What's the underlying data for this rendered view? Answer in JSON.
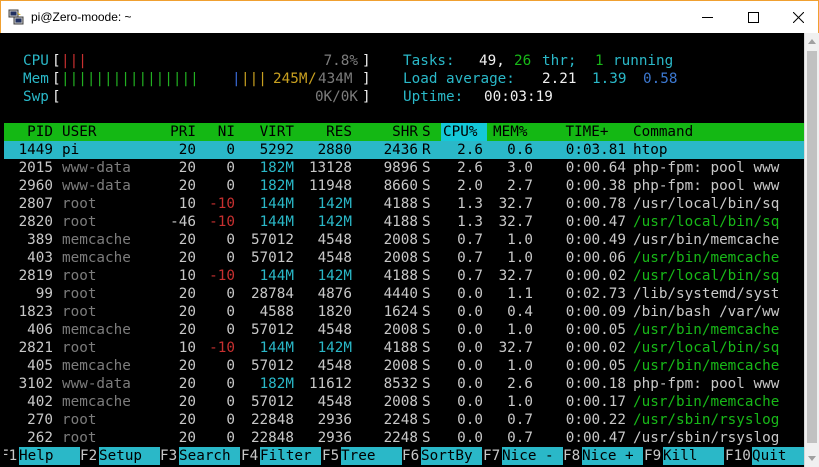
{
  "window": {
    "title": "pi@Zero-moode: ~",
    "minimize_label": "─",
    "maximize_label": "☐",
    "close_label": "✕"
  },
  "meters": {
    "cpu": {
      "label": "CPU",
      "bar": "|||",
      "value": "7.8%"
    },
    "mem": {
      "label": "Mem",
      "bar_green": "||||||||||||||||",
      "bar_blue": "|",
      "bar_yellow": "|||",
      "used": "245M",
      "sep": "/",
      "total": "434M"
    },
    "swp": {
      "label": "Swp",
      "value": "0K/0K"
    },
    "tasks": {
      "label": "Tasks:",
      "count": "49,",
      "thr": "26",
      "thr_label": "thr;",
      "running": "1",
      "running_label": "running"
    },
    "load": {
      "label": "Load average:",
      "v1": "2.21",
      "v5": "1.39",
      "v15": "0.58"
    },
    "uptime": {
      "label": "Uptime:",
      "value": "00:03:19"
    }
  },
  "columns": [
    "PID",
    "USER",
    "PRI",
    "NI",
    "VIRT",
    "RES",
    "SHR",
    "S",
    "CPU%",
    "MEM%",
    "TIME+",
    "Command"
  ],
  "processes": [
    {
      "pid": "1449",
      "user": "pi",
      "pri": "20",
      "ni": "0",
      "virt": "5292",
      "res": "2880",
      "shr": "2436",
      "s": "R",
      "cpu": "2.6",
      "mem": "0.6",
      "time": "0:03.81",
      "cmd": "htop"
    },
    {
      "pid": "2015",
      "user": "www-data",
      "pri": "20",
      "ni": "0",
      "virt": "182M",
      "res": "13128",
      "shr": "9896",
      "s": "S",
      "cpu": "2.6",
      "mem": "3.0",
      "time": "0:00.64",
      "cmd": "php-fpm: pool www"
    },
    {
      "pid": "2960",
      "user": "www-data",
      "pri": "20",
      "ni": "0",
      "virt": "182M",
      "res": "11948",
      "shr": "8660",
      "s": "S",
      "cpu": "2.0",
      "mem": "2.7",
      "time": "0:00.38",
      "cmd": "php-fpm: pool www"
    },
    {
      "pid": "2807",
      "user": "root",
      "pri": "10",
      "ni": "-10",
      "virt": "144M",
      "res": "142M",
      "shr": "4188",
      "s": "S",
      "cpu": "1.3",
      "mem": "32.7",
      "time": "0:00.78",
      "cmd": "/usr/local/bin/sq"
    },
    {
      "pid": "2820",
      "user": "root",
      "pri": "-46",
      "ni": "-10",
      "virt": "144M",
      "res": "142M",
      "shr": "4188",
      "s": "S",
      "cpu": "1.3",
      "mem": "32.7",
      "time": "0:00.47",
      "cmd": "/usr/local/bin/sq"
    },
    {
      "pid": "389",
      "user": "memcache",
      "pri": "20",
      "ni": "0",
      "virt": "57012",
      "res": "4548",
      "shr": "2008",
      "s": "S",
      "cpu": "0.7",
      "mem": "1.0",
      "time": "0:00.49",
      "cmd": "/usr/bin/memcache"
    },
    {
      "pid": "403",
      "user": "memcache",
      "pri": "20",
      "ni": "0",
      "virt": "57012",
      "res": "4548",
      "shr": "2008",
      "s": "S",
      "cpu": "0.7",
      "mem": "1.0",
      "time": "0:00.06",
      "cmd": "/usr/bin/memcache"
    },
    {
      "pid": "2819",
      "user": "root",
      "pri": "10",
      "ni": "-10",
      "virt": "144M",
      "res": "142M",
      "shr": "4188",
      "s": "S",
      "cpu": "0.7",
      "mem": "32.7",
      "time": "0:00.02",
      "cmd": "/usr/local/bin/sq"
    },
    {
      "pid": "99",
      "user": "root",
      "pri": "20",
      "ni": "0",
      "virt": "28784",
      "res": "4876",
      "shr": "4440",
      "s": "S",
      "cpu": "0.0",
      "mem": "1.1",
      "time": "0:02.73",
      "cmd": "/lib/systemd/syst"
    },
    {
      "pid": "1823",
      "user": "root",
      "pri": "20",
      "ni": "0",
      "virt": "4588",
      "res": "1820",
      "shr": "1624",
      "s": "S",
      "cpu": "0.0",
      "mem": "0.4",
      "time": "0:00.09",
      "cmd": "/bin/bash /var/ww"
    },
    {
      "pid": "406",
      "user": "memcache",
      "pri": "20",
      "ni": "0",
      "virt": "57012",
      "res": "4548",
      "shr": "2008",
      "s": "S",
      "cpu": "0.0",
      "mem": "1.0",
      "time": "0:00.05",
      "cmd": "/usr/bin/memcache"
    },
    {
      "pid": "2821",
      "user": "root",
      "pri": "10",
      "ni": "-10",
      "virt": "144M",
      "res": "142M",
      "shr": "4188",
      "s": "S",
      "cpu": "0.0",
      "mem": "32.7",
      "time": "0:00.02",
      "cmd": "/usr/local/bin/sq"
    },
    {
      "pid": "405",
      "user": "memcache",
      "pri": "20",
      "ni": "0",
      "virt": "57012",
      "res": "4548",
      "shr": "2008",
      "s": "S",
      "cpu": "0.0",
      "mem": "1.0",
      "time": "0:00.05",
      "cmd": "/usr/bin/memcache"
    },
    {
      "pid": "3102",
      "user": "www-data",
      "pri": "20",
      "ni": "0",
      "virt": "182M",
      "res": "11612",
      "shr": "8532",
      "s": "S",
      "cpu": "0.0",
      "mem": "2.6",
      "time": "0:00.18",
      "cmd": "php-fpm: pool www"
    },
    {
      "pid": "402",
      "user": "memcache",
      "pri": "20",
      "ni": "0",
      "virt": "57012",
      "res": "4548",
      "shr": "2008",
      "s": "S",
      "cpu": "0.0",
      "mem": "1.0",
      "time": "0:00.17",
      "cmd": "/usr/bin/memcache"
    },
    {
      "pid": "270",
      "user": "root",
      "pri": "20",
      "ni": "0",
      "virt": "22848",
      "res": "2936",
      "shr": "2248",
      "s": "S",
      "cpu": "0.0",
      "mem": "0.7",
      "time": "0:00.22",
      "cmd": "/usr/sbin/rsyslog"
    },
    {
      "pid": "262",
      "user": "root",
      "pri": "20",
      "ni": "0",
      "virt": "22848",
      "res": "2936",
      "shr": "2248",
      "s": "S",
      "cpu": "0.0",
      "mem": "0.7",
      "time": "0:00.47",
      "cmd": "/usr/sbin/rsyslog"
    }
  ],
  "fkeys": [
    {
      "key": "F1",
      "label": "Help  "
    },
    {
      "key": "F2",
      "label": "Setup "
    },
    {
      "key": "F3",
      "label": "Search"
    },
    {
      "key": "F4",
      "label": "Filter"
    },
    {
      "key": "F5",
      "label": "Tree  "
    },
    {
      "key": "F6",
      "label": "SortBy"
    },
    {
      "key": "F7",
      "label": "Nice -"
    },
    {
      "key": "F8",
      "label": "Nice +"
    },
    {
      "key": "F9",
      "label": "Kill  "
    },
    {
      "key": "F10",
      "label": "Quit "
    }
  ],
  "colors": {
    "header_bg": "#14b814",
    "selected_bg": "#2ab8c8",
    "sort_col_bg": "#14c8d8"
  }
}
